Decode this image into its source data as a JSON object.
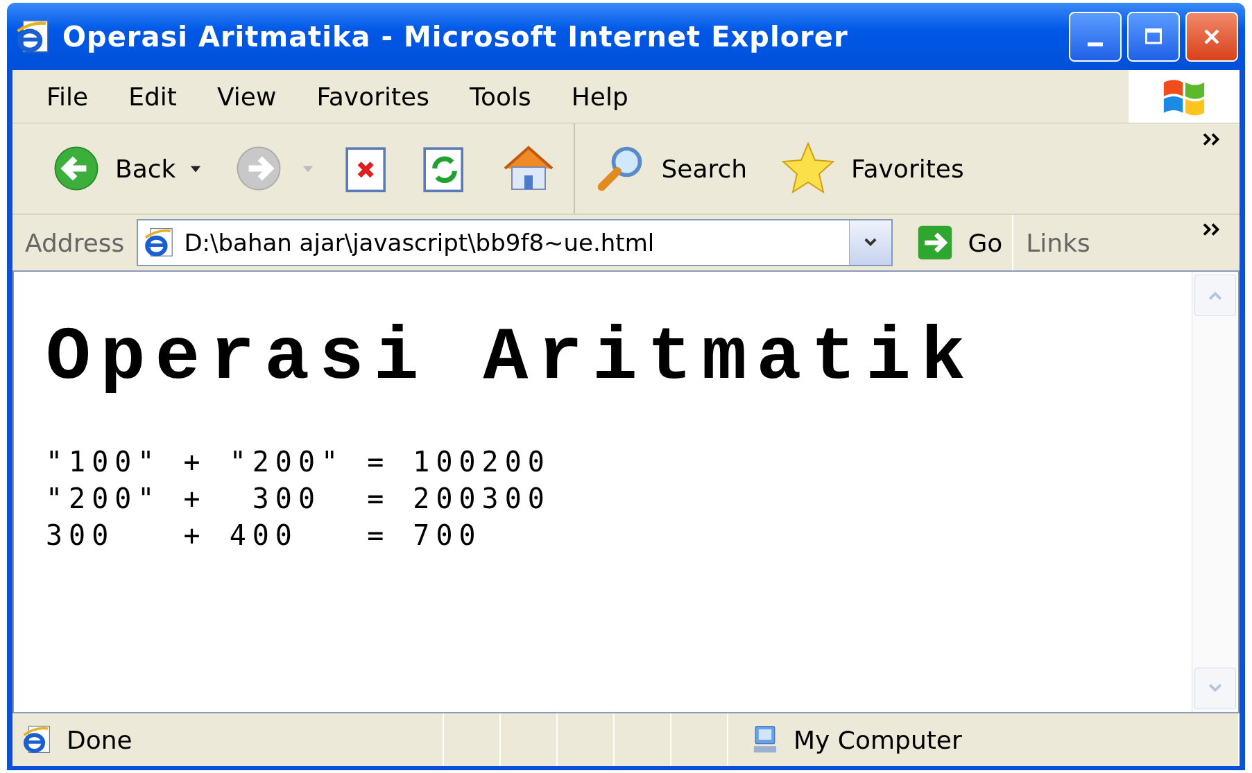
{
  "window": {
    "title": "Operasi Aritmatika - Microsoft Internet Explorer"
  },
  "menu": [
    "File",
    "Edit",
    "View",
    "Favorites",
    "Tools",
    "Help"
  ],
  "toolbar": [
    {
      "kind": "back",
      "label": "Back",
      "disabled": false
    },
    {
      "kind": "forward",
      "disabled": true
    },
    {
      "kind": "stop"
    },
    {
      "kind": "refresh"
    },
    {
      "kind": "home"
    },
    {
      "kind": "search",
      "label": "Search"
    },
    {
      "kind": "favorites",
      "label": "Favorites"
    }
  ],
  "address": {
    "label": "Address",
    "value": "D:\\bahan ajar\\javascript\\bb9f8~ue.html",
    "go": "Go",
    "links": "Links"
  },
  "page": {
    "heading": "Operasi Aritmatik",
    "lines": [
      "\"100\" + \"200\" = 100200",
      "\"200\" +  300  = 200300",
      "300   + 400   = 700"
    ]
  },
  "status_bar": {
    "status": "Done",
    "zone": "My Computer"
  }
}
